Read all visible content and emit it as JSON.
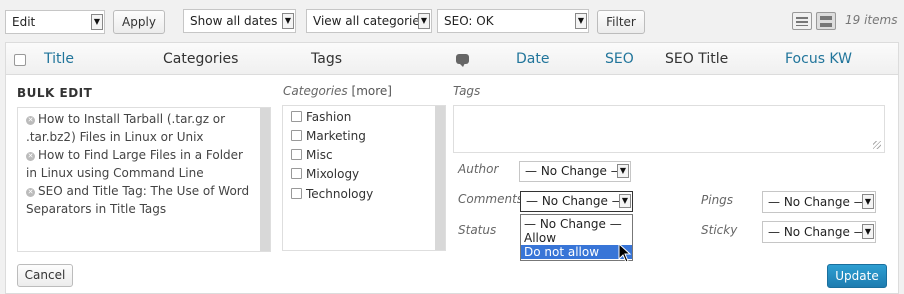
{
  "filters": {
    "bulk_action": "Edit",
    "apply_label": "Apply",
    "dates": "Show all dates",
    "categories": "View all categories",
    "seo": "SEO: OK",
    "filter_label": "Filter",
    "items_count": "19 items"
  },
  "columns": {
    "title": "Title",
    "categories": "Categories",
    "tags": "Tags",
    "date": "Date",
    "seo": "SEO",
    "seo_title": "SEO Title",
    "focus_kw": "Focus KW"
  },
  "bulk_edit": {
    "heading": "BULK EDIT",
    "titles": [
      "How to Install Tarball (.tar.gz or .tar.bz2) Files in Linux or Unix",
      "How to Find Large Files in a Folder in Linux using Command Line",
      "SEO and Title Tag: The Use of Word Separators in Title Tags"
    ],
    "categories_label": "Categories",
    "more_label": "[more]",
    "category_options": [
      "Fashion",
      "Marketing",
      "Misc",
      "Mixology",
      "Technology"
    ],
    "tags_label": "Tags",
    "tags_value": "",
    "author_label": "Author",
    "author_value": "— No Change —",
    "comments_label": "Comments",
    "comments_value": "— No Change —",
    "comments_options": [
      "— No Change —",
      "Allow",
      "Do not allow"
    ],
    "comments_highlighted": "Do not allow",
    "status_label": "Status",
    "pings_label": "Pings",
    "pings_value": "— No Change —",
    "sticky_label": "Sticky",
    "sticky_value": "— No Change —",
    "cancel_label": "Cancel",
    "update_label": "Update"
  },
  "colors": {
    "link": "#21759b",
    "primary": "#1e7cb0",
    "highlight": "#3875d7"
  }
}
